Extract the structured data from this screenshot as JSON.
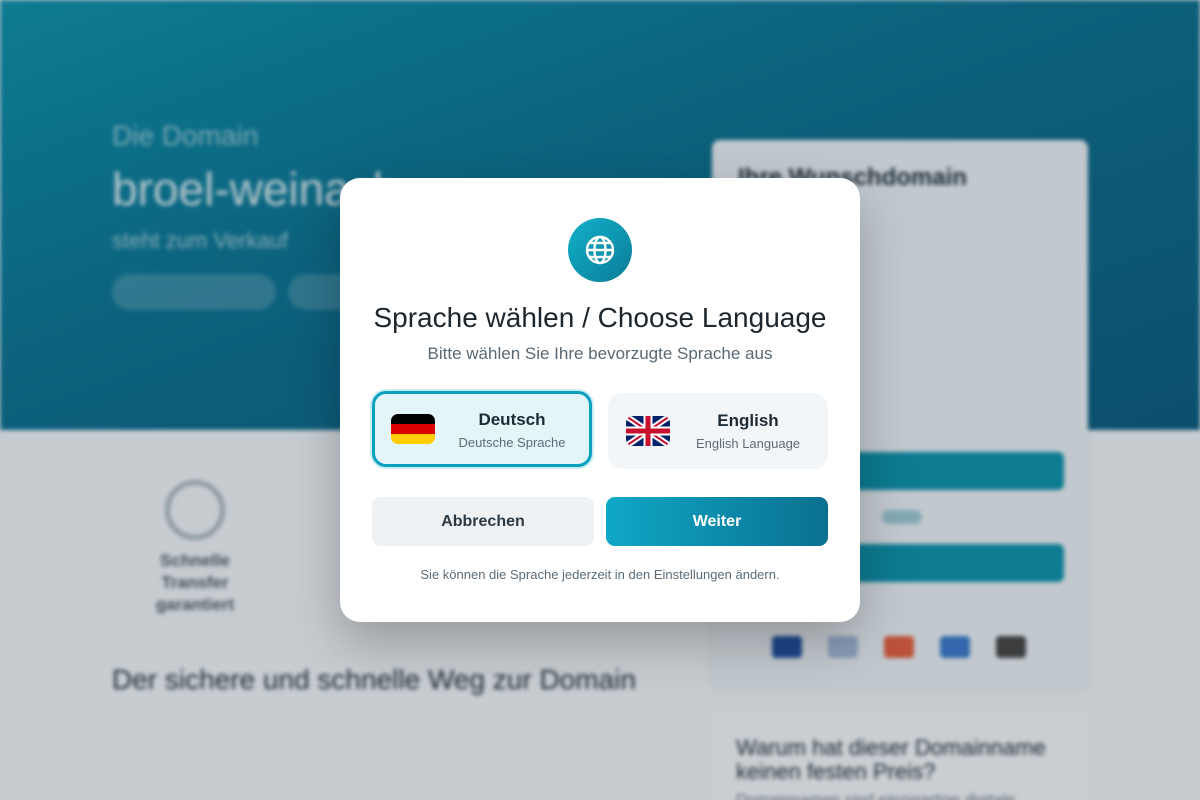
{
  "colors": {
    "accent": "#0aa1bf",
    "hero": "#0a6f8f",
    "button_gradient_start": "#0fa8c6",
    "button_gradient_end": "#0a7090"
  },
  "background": {
    "hero": {
      "eyebrow": "Die Domain",
      "title": "broel-weinach",
      "subtitle": "steht zum Verkauf"
    },
    "sidecard": {
      "title": "Ihre Wunschdomain"
    },
    "features": [
      "Schnelle Transfer garantiert"
    ],
    "content_title": "Der sichere und schnelle Weg zur Domain",
    "sidecard2_title": "Warum hat dieser Domainname keinen festen Preis?",
    "sidecard2_text": "Domainnamen sind einzigartige digitale"
  },
  "modal": {
    "icon": "globe-icon",
    "title": "Sprache wählen / Choose Language",
    "subtitle": "Bitte wählen Sie Ihre bevorzugte Sprache aus",
    "languages": [
      {
        "name": "Deutsch",
        "description": "Deutsche Sprache",
        "flag": "de-flag-icon",
        "selected": true
      },
      {
        "name": "English",
        "description": "English Language",
        "flag": "uk-flag-icon",
        "selected": false
      }
    ],
    "cancel_label": "Abbrechen",
    "next_label": "Weiter",
    "note": "Sie können die Sprache jederzeit in den Einstellungen ändern."
  }
}
